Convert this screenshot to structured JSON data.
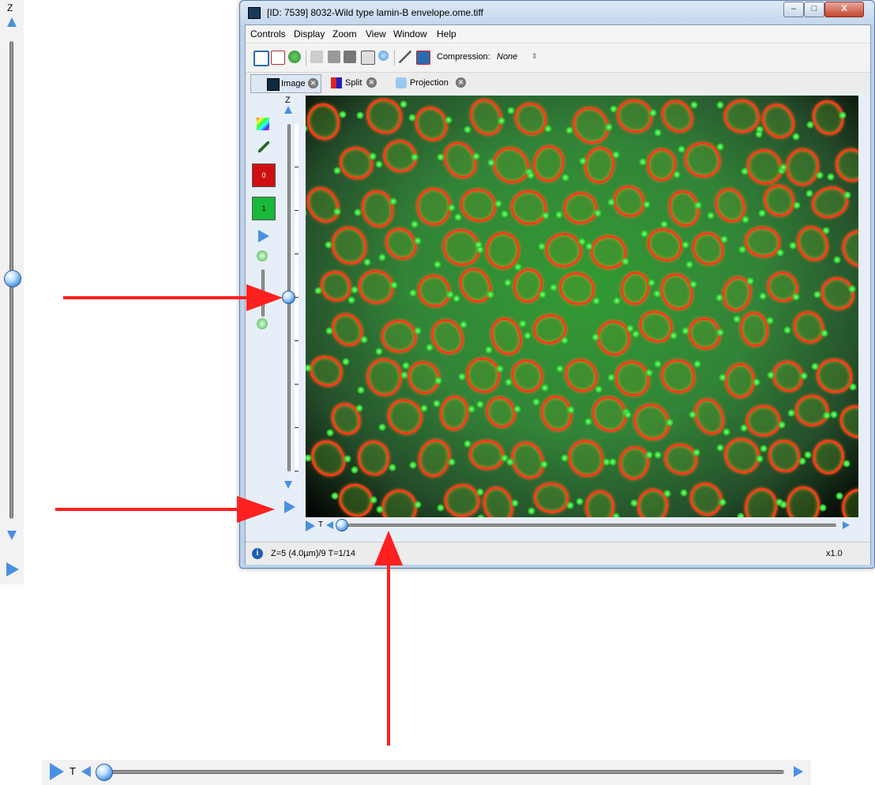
{
  "window": {
    "title": "[ID: 7539] 8032-Wild type lamin-B envelope.ome.tiff",
    "controls": {
      "minimize": "–",
      "maximize": "□",
      "close": "X"
    }
  },
  "menu": [
    "Controls",
    "Display",
    "Zoom",
    "View",
    "Window",
    "Help"
  ],
  "toolbar": {
    "compression_label": "Compression:",
    "compression_value": "None",
    "icons": [
      "save-icon",
      "edit-icon",
      "refresh-icon",
      "copy-icon",
      "paste-icon",
      "stop-icon",
      "movie-icon",
      "zoom-icon",
      "measure-icon",
      "export-icon"
    ]
  },
  "tabs": [
    {
      "label": "Image",
      "icon": "image-icon"
    },
    {
      "label": "Split",
      "icon": "split-icon"
    },
    {
      "label": "Projection",
      "icon": "projection-icon"
    }
  ],
  "left_panel": {
    "channels": [
      {
        "label": "0",
        "color": "#d01010"
      },
      {
        "label": "1",
        "color": "#18b83a"
      }
    ]
  },
  "z_slider": {
    "label": "Z",
    "value": 5,
    "max": 9
  },
  "t_slider": {
    "label": "T",
    "value": 1,
    "max": 14
  },
  "status": {
    "text": "Z=5 (4.0µm)/9 T=1/14",
    "zoom": "x1.0"
  },
  "colors": {
    "accent": "#4a90e2",
    "arrow": "#ff2020",
    "membrane": "#ff3b1a",
    "background_signal": "#2f9a35"
  }
}
